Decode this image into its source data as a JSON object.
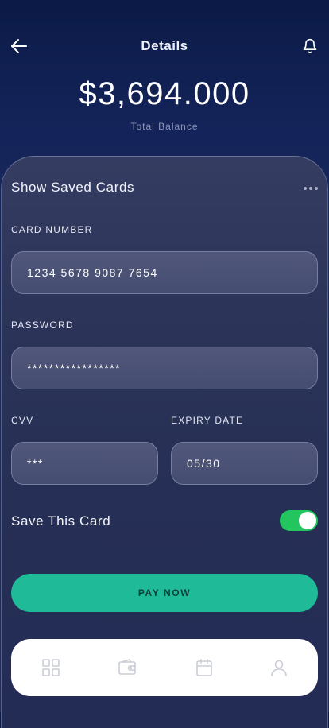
{
  "header": {
    "title": "Details"
  },
  "balance": {
    "amount": "$3,694.000",
    "label": "Total Balance"
  },
  "saved_cards": {
    "label": "Show Saved Cards"
  },
  "form": {
    "card_number": {
      "label": "CARD NUMBER",
      "value": "1234 5678 9087 7654"
    },
    "password": {
      "label": "PASSWORD",
      "value": "*****************"
    },
    "cvv": {
      "label": "CVV",
      "value": "***"
    },
    "expiry": {
      "label": "EXPIRY DATE",
      "value": "05/30"
    }
  },
  "save_card": {
    "label": "Save This Card",
    "enabled": true
  },
  "pay_button": {
    "label": "PAY NOW"
  },
  "icons": {
    "back": "arrow-left-icon",
    "bell": "bell-icon",
    "more": "more-horizontal-icon",
    "nav": [
      "grid-icon",
      "wallet-icon",
      "calendar-icon",
      "user-icon"
    ]
  },
  "colors": {
    "accent": "#1fbb98",
    "toggle_on": "#22c55e",
    "background": "#14245a",
    "nav_icon": "#c9cdd6"
  }
}
